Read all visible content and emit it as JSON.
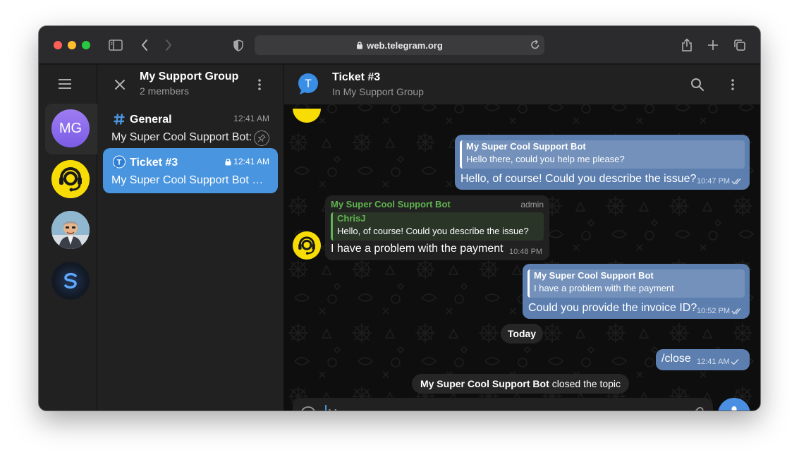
{
  "browser": {
    "url": "web.telegram.org"
  },
  "rail": {
    "items": [
      {
        "initials": "MG",
        "color": "#8a6cec"
      },
      {
        "icon": "support-bot-avatar-icon",
        "color": "#f7dc06"
      },
      {
        "icon": "man-avatar-icon"
      },
      {
        "icon": "s-logo-avatar-icon"
      }
    ]
  },
  "group": {
    "title": "My Support Group",
    "subtitle": "2 members"
  },
  "topics": [
    {
      "title": "General",
      "time": "12:41 AM",
      "preview": "My Super Cool Support Bot:",
      "icon": "hash-icon",
      "pinned": true
    },
    {
      "title": "Ticket #3",
      "time": "12:41 AM",
      "preview": "My Super Cool Support Bot closed the topic",
      "icon": "topic-t-icon",
      "locked": true,
      "active": true
    }
  ],
  "chat": {
    "avatar_letter": "T",
    "title": "Ticket #3",
    "subtitle": "In My Support Group",
    "messages": [
      {
        "direction": "out",
        "reply_name": "My Super Cool Support Bot",
        "reply_text": "Hello there, could you help me please?",
        "text": "Hello, of course! Could you describe the issue?",
        "time": "10:47 PM"
      },
      {
        "direction": "in",
        "sender": "My Super Cool Support Bot",
        "role": "admin",
        "reply_name": "ChrisJ",
        "reply_text": "Hello, of course! Could you describe the issue?",
        "text": "I have a problem with the payment",
        "time": "10:48 PM"
      },
      {
        "direction": "out",
        "reply_name": "My Super Cool Support Bot",
        "reply_text": "I have a problem with the payment",
        "text": "Could you provide the invoice ID?",
        "time": "10:52 PM"
      },
      {
        "direction": "out",
        "text": "/close",
        "time": "12:41 AM"
      }
    ],
    "date_separator": "Today",
    "service": {
      "actor": "My Super Cool Support Bot",
      "action": "closed the topic"
    }
  },
  "composer": {
    "placeholder": "Message"
  },
  "colors": {
    "accent": "#4a95df",
    "outgoing_bubble": "#5c7fb0",
    "incoming_bubble": "#212121",
    "sender_green": "#5fb44f"
  }
}
